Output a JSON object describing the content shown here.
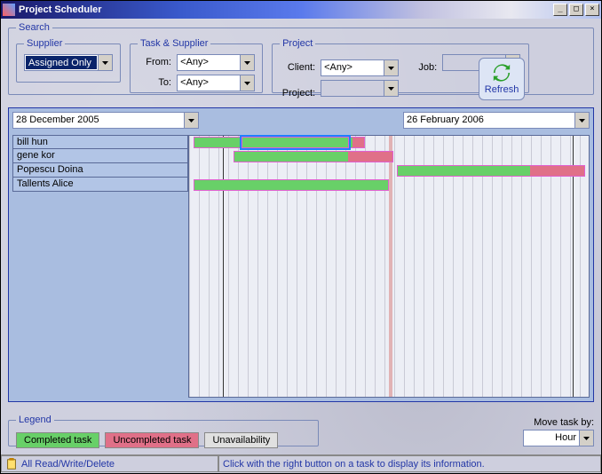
{
  "window": {
    "title": "Project Scheduler"
  },
  "search": {
    "label": "Search",
    "supplier": {
      "legend": "Supplier",
      "value": "Assigned Only"
    },
    "task_supplier": {
      "legend": "Task & Supplier",
      "from_label": "From:",
      "from_value": "<Any>",
      "to_label": "To:",
      "to_value": "<Any>"
    },
    "project": {
      "legend": "Project",
      "client_label": "Client:",
      "client_value": "<Any>",
      "project_label": "Project:",
      "project_value": "",
      "job_label": "Job:",
      "job_value": ""
    },
    "refresh_label": "Refresh"
  },
  "date_range": {
    "start": "28 December 2005",
    "end": "26  February  2006"
  },
  "rows": [
    {
      "name": "bill hun"
    },
    {
      "name": "gene kor"
    },
    {
      "name": "Popescu Doina"
    },
    {
      "name": "Tallents Alice"
    }
  ],
  "legend": {
    "label": "Legend",
    "completed": "Completed task",
    "uncompleted": "Uncompleted task",
    "unavail": "Unavailability"
  },
  "move": {
    "label": "Move task by:",
    "value": "Hour"
  },
  "status": {
    "perm": "All Read/Write/Delete",
    "hint": "Click with the right button on a task to display its information."
  },
  "chart_data": {
    "type": "gantt",
    "x_start": "2005-12-28",
    "x_end": "2006-02-26",
    "today_marker": "2006-01-25",
    "tasks": [
      {
        "row": 0,
        "left_pct": 1,
        "width_pct": 43,
        "done_pct": 93,
        "highlight_inner": {
          "left_pct": 13,
          "width_pct": 27
        }
      },
      {
        "row": 1,
        "left_pct": 11,
        "width_pct": 40,
        "done_pct": 72
      },
      {
        "row": 2,
        "left_pct": 52,
        "width_pct": 47,
        "done_pct": 71
      },
      {
        "row": 3,
        "left_pct": 1,
        "width_pct": 49,
        "done_pct": 100
      }
    ]
  }
}
